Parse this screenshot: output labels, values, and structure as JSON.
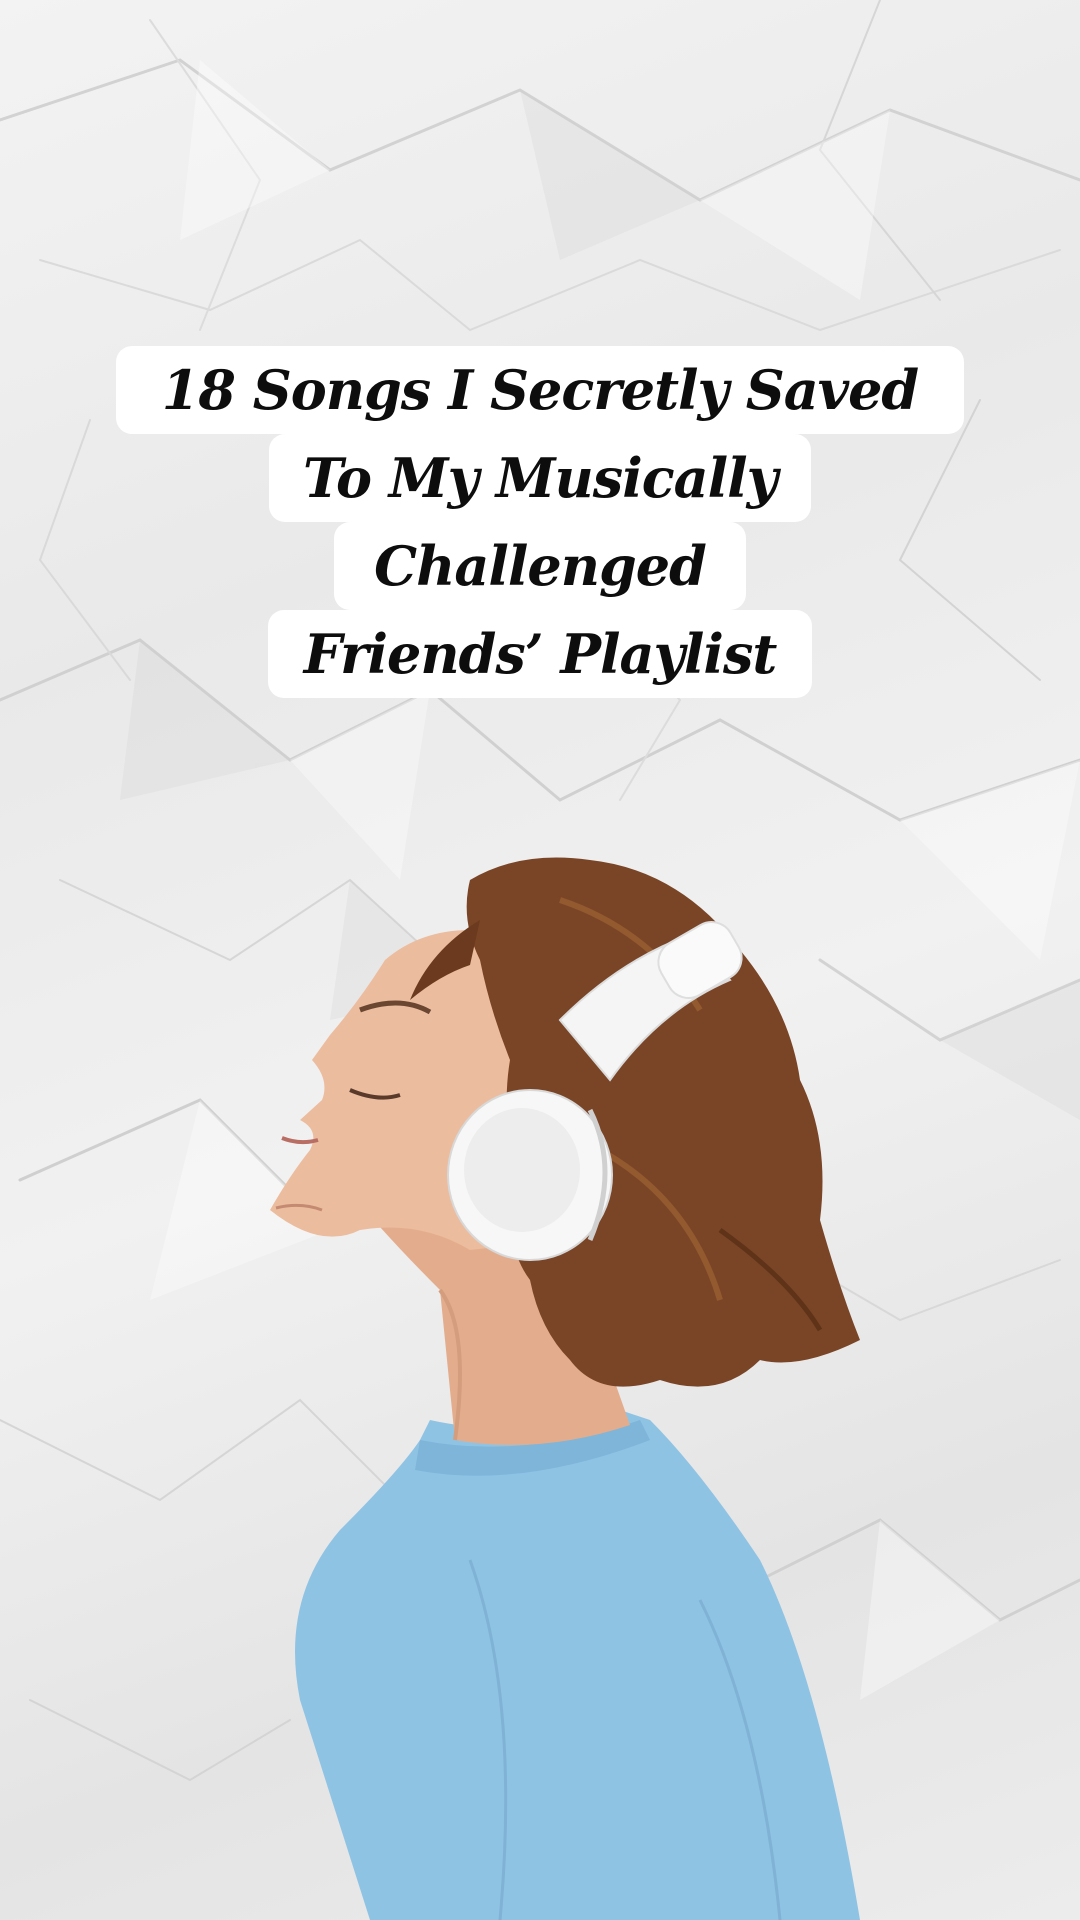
{
  "title": {
    "lines": [
      "18 Songs I Secretly Saved",
      "To My Musically",
      "Challenged",
      "Friends’ Playlist"
    ]
  },
  "image": {
    "subject": "woman-with-headphones-icon",
    "colors": {
      "background": "#ececec",
      "sweater": "#8fc3e4",
      "hair": "#7a4526",
      "skin": "#e9b99b",
      "headphones": "#f7f7f7"
    }
  }
}
